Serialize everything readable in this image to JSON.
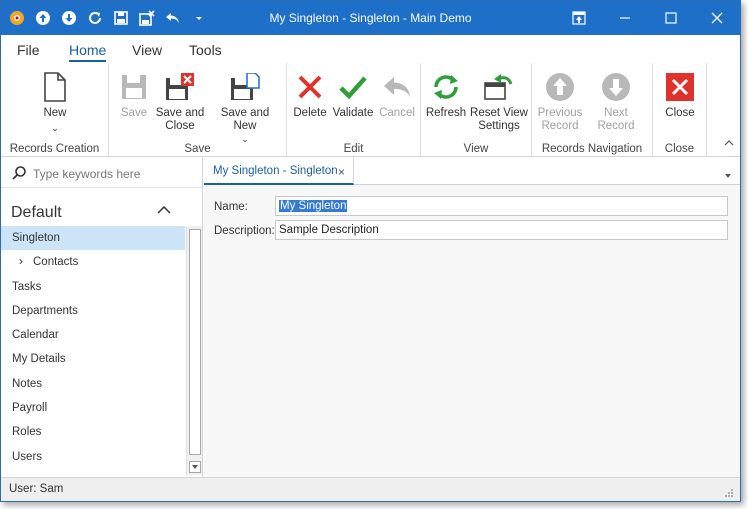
{
  "window": {
    "title": "My Singleton - Singleton - Main Demo"
  },
  "menu_tabs": [
    "File",
    "Home",
    "View",
    "Tools"
  ],
  "ribbon": {
    "groups": {
      "records_creation": {
        "caption": "Records Creation",
        "new_label": "New"
      },
      "save": {
        "caption": "Save",
        "save_label": "Save",
        "save_close_label_1": "Save and",
        "save_close_label_2": "Close",
        "save_new_label": "Save and New"
      },
      "edit": {
        "caption": "Edit",
        "delete_label": "Delete",
        "validate_label": "Validate",
        "cancel_label": "Cancel"
      },
      "view": {
        "caption": "View",
        "refresh_label": "Refresh",
        "reset_label_1": "Reset View",
        "reset_label_2": "Settings"
      },
      "nav": {
        "caption": "Records Navigation",
        "prev_label_1": "Previous",
        "prev_label_2": "Record",
        "next_label": "Next Record"
      },
      "close": {
        "caption": "Close",
        "close_label": "Close"
      }
    }
  },
  "navigation": {
    "search_placeholder": "Type keywords here",
    "group_title": "Default",
    "items": [
      "Singleton",
      "Contacts",
      "Tasks",
      "Departments",
      "Calendar",
      "My Details",
      "Notes",
      "Payroll",
      "Roles",
      "Users"
    ]
  },
  "document": {
    "tab_label": "My Singleton - Singleton",
    "close_glyph": "×",
    "fields": {
      "name_label": "Name:",
      "name_value": "My Singleton",
      "description_label": "Description:",
      "description_value": "Sample Description"
    }
  },
  "status": {
    "user_text": "User: Sam"
  },
  "colors": {
    "titlebar": "#1e6fc7",
    "accent": "#1a5fa8",
    "delete_red": "#e0322d",
    "validate_green": "#2e9e3a",
    "refresh_green": "#2e9e3a",
    "close_red": "#e0322d",
    "selection": "#cce4f7"
  }
}
